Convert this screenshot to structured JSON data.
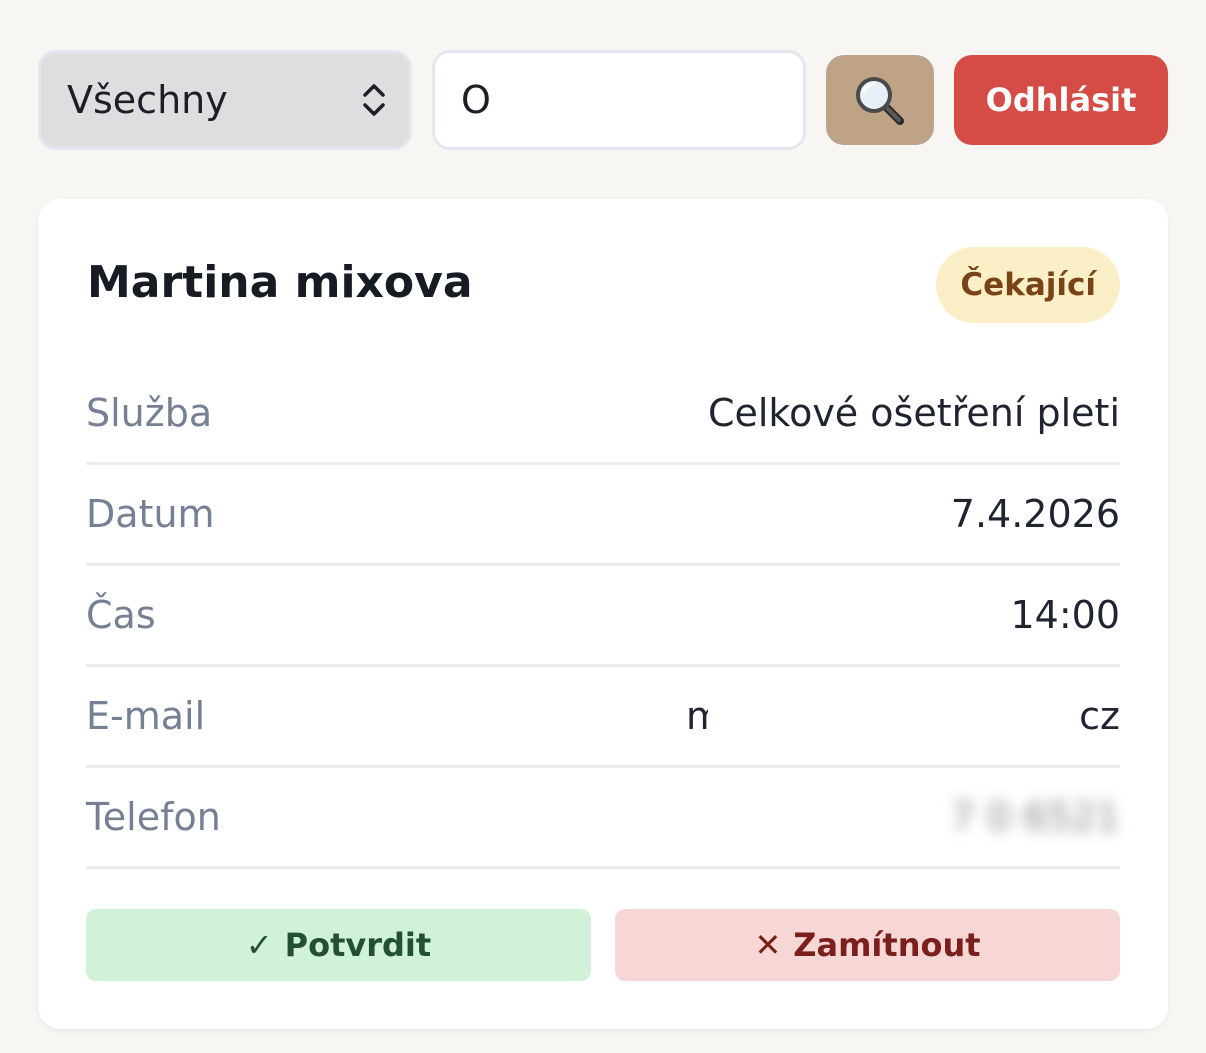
{
  "toolbar": {
    "filter_select": {
      "selected": "Všechny",
      "icon": "chevron-up-down-icon"
    },
    "search": {
      "value": "O",
      "placeholder": ""
    },
    "search_button_icon": "magnifier-icon",
    "logout_label": "Odhlásit"
  },
  "card": {
    "customer_name": "Martina mixova",
    "status": "Čekající",
    "rows": [
      {
        "label": "Služba",
        "value": "Celkové ošetření pleti"
      },
      {
        "label": "Datum",
        "value": "7.4.2026"
      },
      {
        "label": "Čas",
        "value": "14:00"
      },
      {
        "label": "E-mail",
        "value_start": "m",
        "value_end": "cz"
      },
      {
        "label": "Telefon",
        "value": "7  0 6521"
      }
    ],
    "confirm": {
      "icon": "✓",
      "label": "Potvrdit"
    },
    "reject": {
      "icon": "✕",
      "label": "Zamítnout"
    }
  },
  "colors": {
    "background": "#f8f6f2",
    "search_button": "#bea386",
    "logout_button": "#d44c45",
    "status_badge_bg": "#fbefc8",
    "status_badge_text": "#7a4316",
    "confirm_bg": "#d1f2d9",
    "confirm_text": "#235130",
    "reject_bg": "#f6d7d6",
    "reject_text": "#7b1f1d"
  }
}
